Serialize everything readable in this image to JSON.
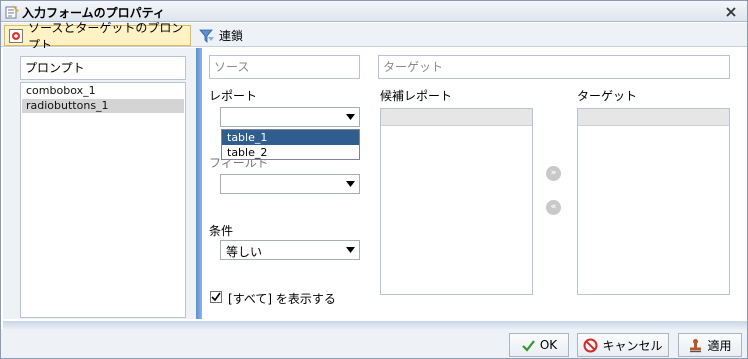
{
  "window": {
    "title": "入力フォームのプロパティ"
  },
  "tabs": [
    {
      "label": "ソースとターゲットのプロンプト",
      "active": true
    },
    {
      "label": "連鎖",
      "active": false
    }
  ],
  "left": {
    "header": "プロンプト",
    "items": [
      {
        "label": "combobox_1",
        "selected": false
      },
      {
        "label": "radiobuttons_1",
        "selected": true
      }
    ]
  },
  "main": {
    "source_placeholder": "ソース",
    "target_placeholder": "ターゲット",
    "report_label": "レポート",
    "report_value": "",
    "report_options": [
      {
        "label": "table_1",
        "highlighted": true
      },
      {
        "label": "table_2",
        "highlighted": false
      }
    ],
    "field_label": "フィールド",
    "field_value": "",
    "condition_label": "条件",
    "condition_value": "等しい",
    "candidate_reports_label": "候補レポート",
    "target_label": "ターゲット",
    "show_all_label": "[すべて] を表示する",
    "show_all_checked": true
  },
  "footer": {
    "ok_label": "OK",
    "cancel_label": "キャンセル",
    "apply_label": "適用"
  },
  "colors": {
    "accent": "#5c8fd4",
    "highlight": "#2f5e8e",
    "active_tab": "#fff3c6"
  }
}
